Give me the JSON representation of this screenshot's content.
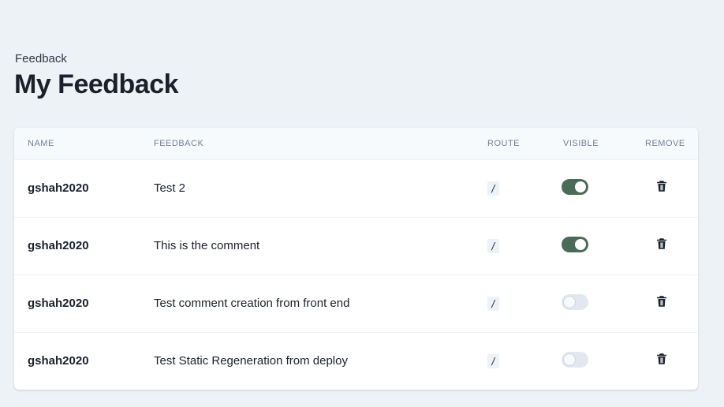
{
  "header": {
    "breadcrumb": "Feedback",
    "title": "My Feedback"
  },
  "table": {
    "columns": {
      "name": "Name",
      "feedback": "Feedback",
      "route": "Route",
      "visible": "Visible",
      "remove": "Remove"
    },
    "rows": [
      {
        "name": "gshah2020",
        "feedback": "Test 2",
        "route": "/",
        "visible": true
      },
      {
        "name": "gshah2020",
        "feedback": "This is the comment",
        "route": "/",
        "visible": true
      },
      {
        "name": "gshah2020",
        "feedback": "Test comment creation from front end",
        "route": "/",
        "visible": false
      },
      {
        "name": "gshah2020",
        "feedback": "Test Static Regeneration from deploy",
        "route": "/",
        "visible": false
      }
    ]
  },
  "icons": {
    "remove": "trash-icon"
  },
  "colors": {
    "background": "#edf2f7",
    "toggle_on": "#4a6b57",
    "toggle_off": "#e2e8f0"
  }
}
